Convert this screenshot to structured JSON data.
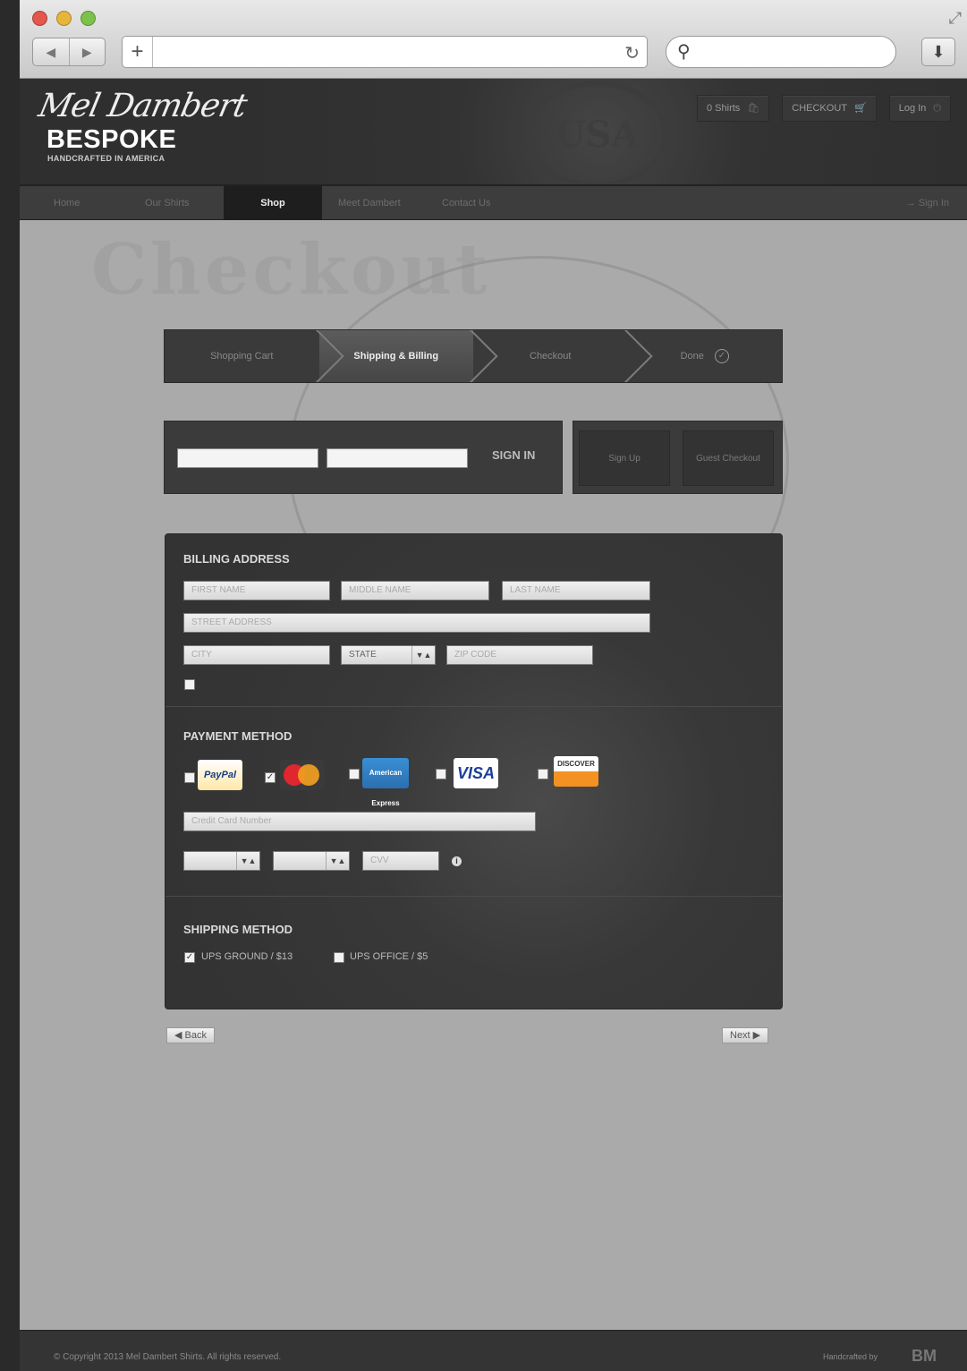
{
  "colors": {
    "accent": "#3a3a3a",
    "content_bg": "#aaaaaa",
    "header_bg": "#333333"
  },
  "chrome": {
    "traffic_lights": [
      "close",
      "minimize",
      "zoom"
    ],
    "back_icon": "◀",
    "forward_icon": "▶",
    "new_tab_icon": "+",
    "reload_icon": "↻",
    "search_icon": "⚲",
    "download_icon": "⬇",
    "fullscreen_icon": "⤢"
  },
  "header": {
    "logo_script": "Mel Dambert",
    "logo_main": "BESPOKE",
    "logo_sub": "HANDCRAFTED IN AMERICA",
    "seal": "USA",
    "buttons": [
      {
        "label": "0 Shirts",
        "icon": "cart-icon",
        "glyph": "🛍"
      },
      {
        "label": "CHECKOUT",
        "icon": "cart-icon",
        "glyph": "🛒"
      },
      {
        "label": "Log In",
        "icon": "power-icon",
        "glyph": "⏻"
      }
    ]
  },
  "nav": {
    "items": [
      "Home",
      "Our Shirts",
      "Shop",
      "Meet Dambert",
      "Contact Us"
    ],
    "active": "Shop",
    "right": "→ Sign In"
  },
  "page": {
    "watermark": "Checkout"
  },
  "steps": [
    {
      "label": "Shopping Cart",
      "active": false
    },
    {
      "label": "Shipping & Billing",
      "active": true
    },
    {
      "label": "Checkout",
      "active": false
    },
    {
      "label": "Done",
      "active": false,
      "done_icon": "✓"
    }
  ],
  "signin": {
    "button": "SIGN IN",
    "register": "Sign Up",
    "guest": "Guest Checkout"
  },
  "billing": {
    "title": "BILLING ADDRESS",
    "first_name": "FIRST NAME",
    "middle_name": "MIDDLE NAME",
    "last_name": "LAST NAME",
    "street": "STREET ADDRESS",
    "city": "CITY",
    "state": "STATE",
    "zip": "ZIP CODE"
  },
  "payment": {
    "title": "PAYMENT METHOD",
    "cards": [
      {
        "name": "PayPal",
        "checked": false
      },
      {
        "name": "MasterCard",
        "checked": true
      },
      {
        "name": "American Express",
        "checked": false
      },
      {
        "name": "VISA",
        "checked": false
      },
      {
        "name": "DISCOVER",
        "checked": false
      }
    ],
    "card_number": "Credit Card Number",
    "cvv": "CVV",
    "arrow": "▼▲",
    "info_icon": "i"
  },
  "shipping": {
    "title": "SHIPPING METHOD",
    "options": [
      {
        "label": "UPS GROUND / $13",
        "checked": true
      },
      {
        "label": "UPS OFFICE / $5",
        "checked": false
      }
    ]
  },
  "pager": {
    "back": "◀ Back",
    "next": "Next ▶"
  },
  "footer": {
    "copyright": "© Copyright 2013 Mel Dambert Shirts. All rights reserved.",
    "credit": "Handcrafted by",
    "brand": "BM"
  }
}
